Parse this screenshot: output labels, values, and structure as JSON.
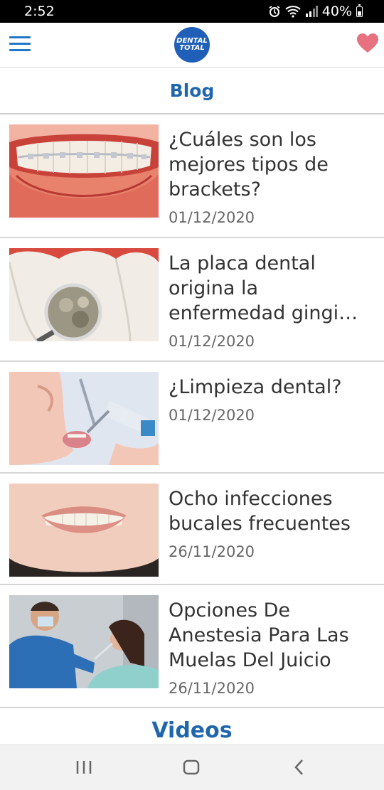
{
  "status_bar": {
    "time": "2:52",
    "battery": "40%",
    "battery_level": 0.4,
    "icons": [
      "alarm-icon",
      "wifi-icon",
      "signal-icon",
      "battery-icon"
    ]
  },
  "header": {
    "logo_line1": "DENTAL",
    "logo_line2": "TOTAL",
    "menu_icon": "hamburger-menu-icon",
    "favorite_icon": "heart-icon"
  },
  "colors": {
    "accent": "#1f66ad",
    "heart": "#e8717f",
    "divider": "#d6d6d6"
  },
  "section_title": "Blog",
  "posts": [
    {
      "title": "¿Cuáles son los mejores tipos de brackets?",
      "date": "01/12/2020",
      "image": "braces-smile"
    },
    {
      "title": "La placa dental origina la enfermedad gingi…",
      "date": "01/12/2020",
      "image": "plaque-magnifier"
    },
    {
      "title": "¿Limpieza dental?",
      "date": "01/12/2020",
      "image": "dental-cleaning"
    },
    {
      "title": "Ocho infecciones bucales frecuentes",
      "date": "26/11/2020",
      "image": "smile"
    },
    {
      "title": "Opciones De Anestesia Para Las Muelas Del Juicio",
      "date": "26/11/2020",
      "image": "dentist-patient"
    }
  ],
  "next_section_title": "Videos",
  "nav": {
    "recents_icon": "recent-apps-icon",
    "home_icon": "home-icon",
    "back_icon": "back-icon"
  }
}
